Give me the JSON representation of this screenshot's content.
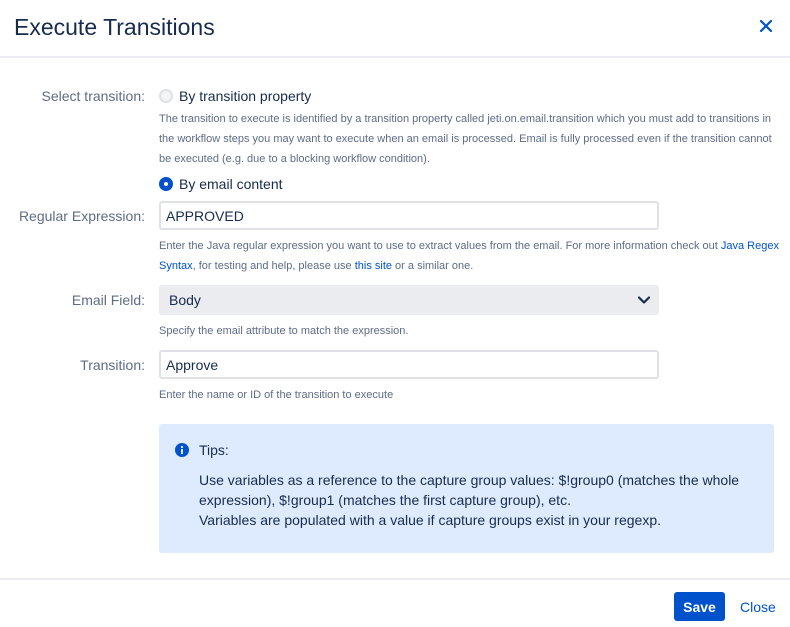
{
  "dialog": {
    "title": "Execute Transitions"
  },
  "select_transition": {
    "label": "Select transition:",
    "option_property": "By transition property",
    "property_help": "The transition to execute is identified by a transition property called jeti.on.email.transition which you must add to transitions in the workflow steps you may want to execute when an email is processed. Email is fully processed even if the transition cannot be executed (e.g. due to a blocking workflow condition).",
    "option_content": "By email content",
    "selected": "By email content"
  },
  "regex": {
    "label": "Regular Expression:",
    "value": "APPROVED",
    "help_before": "Enter the Java regular expression you want to use to extract values from the email. For more information check out ",
    "help_link1": "Java Regex Syntax",
    "help_middle": ", for testing and help, please use ",
    "help_link2": "this site",
    "help_after": " or a similar one."
  },
  "email_field": {
    "label": "Email Field:",
    "value": "Body",
    "help": "Specify the email attribute to match the expression."
  },
  "transition": {
    "label": "Transition:",
    "value": "Approve",
    "help": "Enter the name or ID of the transition to execute"
  },
  "tips": {
    "title": "Tips:",
    "line1": "Use variables as a reference to the capture group values: $!group0 (matches the whole expression), $!group1 (matches the first capture group), etc.",
    "line2": "Variables are populated with a value if capture groups exist in your regexp."
  },
  "footer": {
    "save_label": "Save",
    "close_label": "Close"
  },
  "colors": {
    "primary": "#0052cc",
    "tips_bg": "#deebff",
    "text": "#172b4d",
    "muted": "#5e6c84"
  },
  "icons": {
    "close": "close-icon",
    "chevron": "chevron-down-icon",
    "info": "info-icon"
  }
}
